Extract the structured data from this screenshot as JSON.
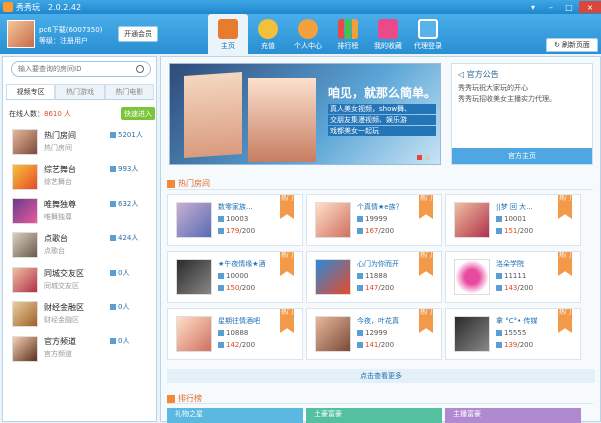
{
  "window": {
    "title": "秀秀玩",
    "version": "2.0.2.42"
  },
  "user": {
    "name": "pc6下载(6007350)",
    "level": "等级：注册用户",
    "vip_button": "开通会员"
  },
  "nav": [
    {
      "label": "主页"
    },
    {
      "label": "充值"
    },
    {
      "label": "个人中心"
    },
    {
      "label": "排行榜"
    },
    {
      "label": "我的收藏"
    },
    {
      "label": "代理登录"
    }
  ],
  "refresh_label": "刷新页面",
  "search": {
    "placeholder": "输入要查询的房间ID"
  },
  "subtabs": [
    "视频专区",
    "热门游戏",
    "热门电影"
  ],
  "online": {
    "label": "在线人数：",
    "count": "8610 人"
  },
  "quick_enter": "快速进入",
  "categories": [
    {
      "title": "热门房间",
      "sub": "热门房间",
      "count": "5201人"
    },
    {
      "title": "综艺舞台",
      "sub": "综艺舞台",
      "count": "993人"
    },
    {
      "title": "唯舞独尊",
      "sub": "唯舞独尊",
      "count": "632人"
    },
    {
      "title": "点歌台",
      "sub": "点歌台",
      "count": "424人"
    },
    {
      "title": "同城交友区",
      "sub": "同城交友区",
      "count": "0人"
    },
    {
      "title": "财经金融区",
      "sub": "财经金融区",
      "count": "0人"
    },
    {
      "title": "官方频道",
      "sub": "官方频道",
      "count": "0人"
    }
  ],
  "banner": {
    "slogan": "咱见，就那么简单。",
    "lines": [
      "真人美女视频，show舞、",
      "交朋友集漫视频、娱乐游",
      "戏都美女一起玩"
    ]
  },
  "notice": {
    "title": "官方公告",
    "line1": "秀秀玩祝大家玩的开心",
    "line2": "秀秀玩招收美女主播实力代理。",
    "home_button": "官方主页"
  },
  "hot_title": "热门房间",
  "rooms": [
    {
      "name": "数零家族...",
      "id": "10003",
      "current": "179",
      "max": "/200",
      "tag": "热门"
    },
    {
      "name": "个真情★e族？",
      "id": "19999",
      "current": "167",
      "max": "/200",
      "tag": "热门"
    },
    {
      "name": "||梦 回 大...",
      "id": "10001",
      "current": "151",
      "max": "/200",
      "tag": "热门"
    },
    {
      "name": "★午夜情缘★酒",
      "id": "10000",
      "current": "150",
      "max": "/200",
      "tag": "热门"
    },
    {
      "name": "心门为你而开",
      "id": "11888",
      "current": "147",
      "max": "/200",
      "tag": "热门"
    },
    {
      "name": "洛朵学院",
      "id": "11111",
      "current": "143",
      "max": "/200",
      "tag": "热门"
    },
    {
      "name": "星期往情酒吧",
      "id": "10888",
      "current": "142",
      "max": "/200",
      "tag": "热门"
    },
    {
      "name": "今夜，叶花真",
      "id": "12999",
      "current": "141",
      "max": "/200",
      "tag": "热门"
    },
    {
      "name": "拿 °C°• 传媒",
      "id": "15555",
      "current": "139",
      "max": "/200",
      "tag": "热门"
    }
  ],
  "more_button": "点击查看更多",
  "rank_title": "排行榜",
  "rank_tabs": [
    "礼物之星",
    "土豪富豪",
    "主播富豪"
  ]
}
